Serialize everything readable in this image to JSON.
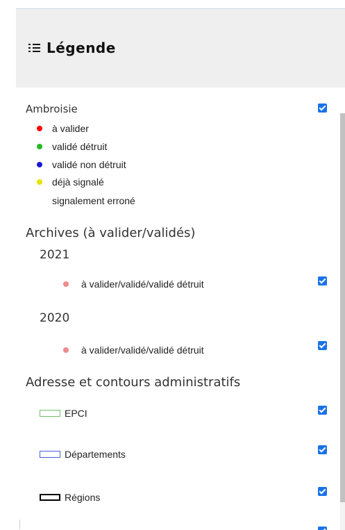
{
  "legend": {
    "title": "Légende"
  },
  "ambroisie": {
    "title": "Ambroisie",
    "checked": true,
    "items": [
      {
        "label": "à valider",
        "color": "#ff0000"
      },
      {
        "label": "validé détruit",
        "color": "#22bb22"
      },
      {
        "label": "validé non détruit",
        "color": "#1a1ad6"
      },
      {
        "label": "déjà signalé",
        "color": "#e5e500"
      },
      {
        "label": "signalement erroné",
        "color": "#ffffff"
      }
    ]
  },
  "archives": {
    "title": "Archives (à valider/validés)",
    "years": [
      {
        "year": "2021",
        "item": "à valider/validé/validé détruit",
        "checked": true,
        "color": "#ef8b8b"
      },
      {
        "year": "2020",
        "item": "à valider/validé/validé détruit",
        "checked": true,
        "color": "#ef8b8b"
      }
    ]
  },
  "admin": {
    "title": "Adresse et contours administratifs",
    "items": [
      {
        "label": "EPCI",
        "border_color": "#6cbf6c",
        "checked": true
      },
      {
        "label": "Départements",
        "border_color": "#4a5be0",
        "checked": true
      },
      {
        "label": "Régions",
        "border_color": "#000000",
        "checked": true
      }
    ]
  },
  "colors": {
    "accent": "#1a73e8",
    "header_bg": "#efefef"
  }
}
